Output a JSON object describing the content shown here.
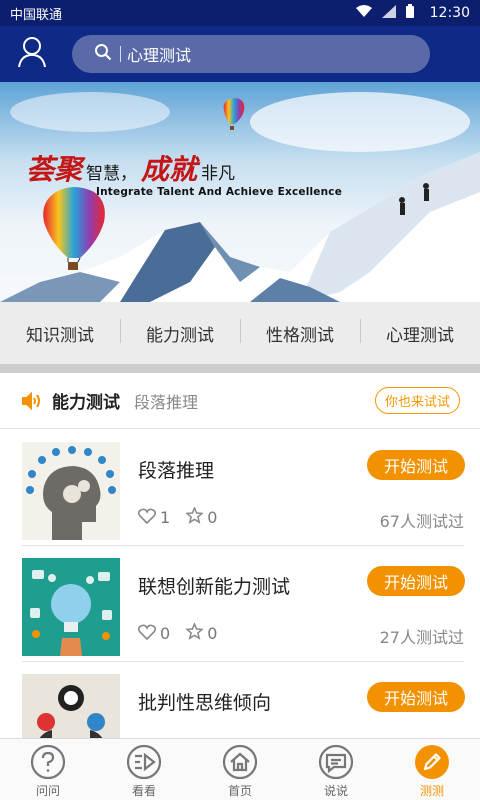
{
  "statusbar": {
    "carrier": "中国联通",
    "time": "12:30"
  },
  "header": {
    "search_placeholder": "心理测试"
  },
  "banner": {
    "calligraphy_1": "荟聚",
    "text_1": "智慧，",
    "calligraphy_2": "成就",
    "text_2": "非凡",
    "subtitle": "Integrate Talent And Achieve Excellence"
  },
  "categories": [
    {
      "label": "知识测试"
    },
    {
      "label": "能力测试"
    },
    {
      "label": "性格测试"
    },
    {
      "label": "心理测试"
    }
  ],
  "section": {
    "category": "能力测试",
    "subcategory": "段落推理",
    "try_label": "你也来试试"
  },
  "tests": [
    {
      "name": "段落推理",
      "likes": "1",
      "favorites": "0",
      "tested": "67人测试过",
      "start_label": "开始测试"
    },
    {
      "name": "联想创新能力测试",
      "likes": "0",
      "favorites": "0",
      "tested": "27人测试过",
      "start_label": "开始测试"
    },
    {
      "name": "批判性思维倾向",
      "start_label": "开始测试"
    }
  ],
  "bottomnav": [
    {
      "label": "问问",
      "icon": "question-icon"
    },
    {
      "label": "看看",
      "icon": "look-icon"
    },
    {
      "label": "首页",
      "icon": "home-icon"
    },
    {
      "label": "说说",
      "icon": "chat-icon"
    },
    {
      "label": "测测",
      "icon": "pencil-icon",
      "active": true
    }
  ],
  "colors": {
    "header": "#0f2a86",
    "accent": "#f39200",
    "status_bar": "#0c1f6e"
  }
}
